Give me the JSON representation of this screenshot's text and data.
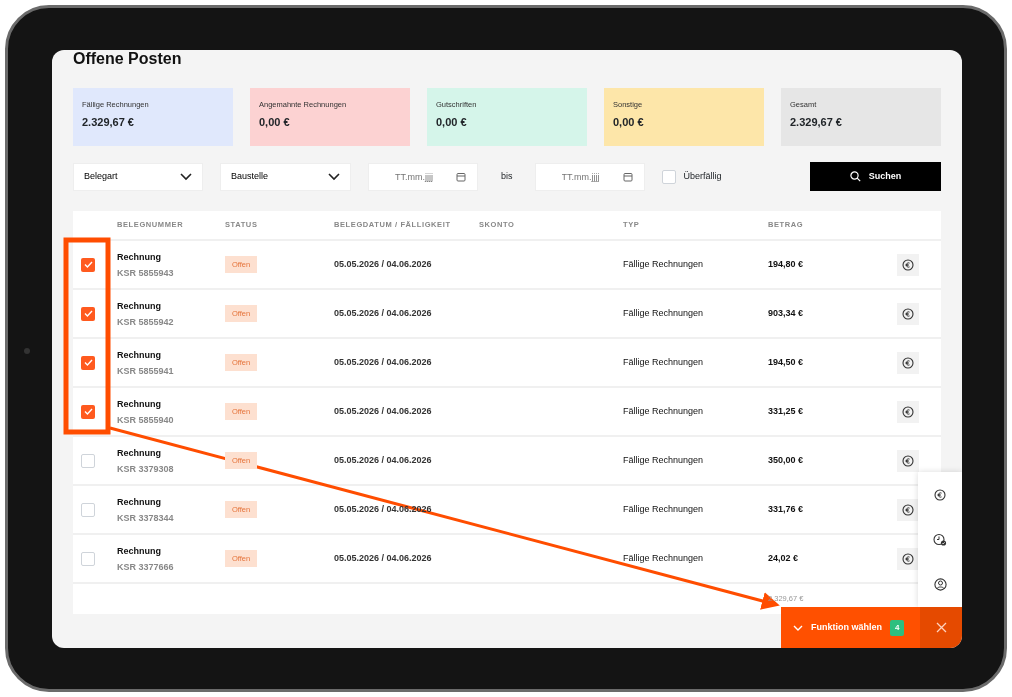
{
  "title": "Offene Posten",
  "summary_cards": [
    {
      "label": "Fällige Rechnungen",
      "value": "2.329,67 €",
      "color": "#e0e8fc"
    },
    {
      "label": "Angemahnte Rechnungen",
      "value": "0,00 €",
      "color": "#fcd2d2"
    },
    {
      "label": "Gutschriften",
      "value": "0,00 €",
      "color": "#d5f5ea"
    },
    {
      "label": "Sonstige",
      "value": "0,00 €",
      "color": "#fde6a9"
    },
    {
      "label": "Gesamt",
      "value": "2.329,67 €",
      "color": "#e6e6e6"
    }
  ],
  "filters": {
    "document_type": {
      "label": "Belegart"
    },
    "site": {
      "label": "Baustelle"
    },
    "date_from": {
      "placeholder": "TT.mm.jjjj"
    },
    "range_separator": "bis",
    "date_to": {
      "placeholder": "TT.mm.jjjj"
    },
    "overdue": {
      "label": "Überfällig",
      "checked": false
    },
    "search_button": "Suchen"
  },
  "table": {
    "columns": [
      "BELEGNUMMER",
      "STATUS",
      "BELEGDATUM / FÄLLIGKEIT",
      "SKONTO",
      "TYP",
      "BETRAG"
    ],
    "rows": [
      {
        "selected": true,
        "document": "Rechnung",
        "number": "KSR 5855943",
        "status": "Offen",
        "dates": "05.05.2026 / 04.06.2026",
        "type": "Fällige Rechnungen",
        "amount": "194,80 €"
      },
      {
        "selected": true,
        "document": "Rechnung",
        "number": "KSR 5855942",
        "status": "Offen",
        "dates": "05.05.2026 / 04.06.2026",
        "type": "Fällige Rechnungen",
        "amount": "903,34 €"
      },
      {
        "selected": true,
        "document": "Rechnung",
        "number": "KSR 5855941",
        "status": "Offen",
        "dates": "05.05.2026 / 04.06.2026",
        "type": "Fällige Rechnungen",
        "amount": "194,50 €"
      },
      {
        "selected": true,
        "document": "Rechnung",
        "number": "KSR 5855940",
        "status": "Offen",
        "dates": "05.05.2026 / 04.06.2026",
        "type": "Fällige Rechnungen",
        "amount": "331,25 €"
      },
      {
        "selected": false,
        "document": "Rechnung",
        "number": "KSR 3379308",
        "status": "Offen",
        "dates": "05.05.2026 / 04.06.2026",
        "type": "Fällige Rechnungen",
        "amount": "350,00 €"
      },
      {
        "selected": false,
        "document": "Rechnung",
        "number": "KSR 3378344",
        "status": "Offen",
        "dates": "05.05.2026 / 04.06.2026",
        "type": "Fällige Rechnungen",
        "amount": "331,76 €"
      },
      {
        "selected": false,
        "document": "Rechnung",
        "number": "KSR 3377666",
        "status": "Offen",
        "dates": "05.05.2026 / 04.06.2026",
        "type": "Fällige Rechnungen",
        "amount": "24,02 €"
      }
    ],
    "total": "2.329,67 €"
  },
  "action_bar": {
    "label": "Funktion wählen",
    "count": "4"
  }
}
